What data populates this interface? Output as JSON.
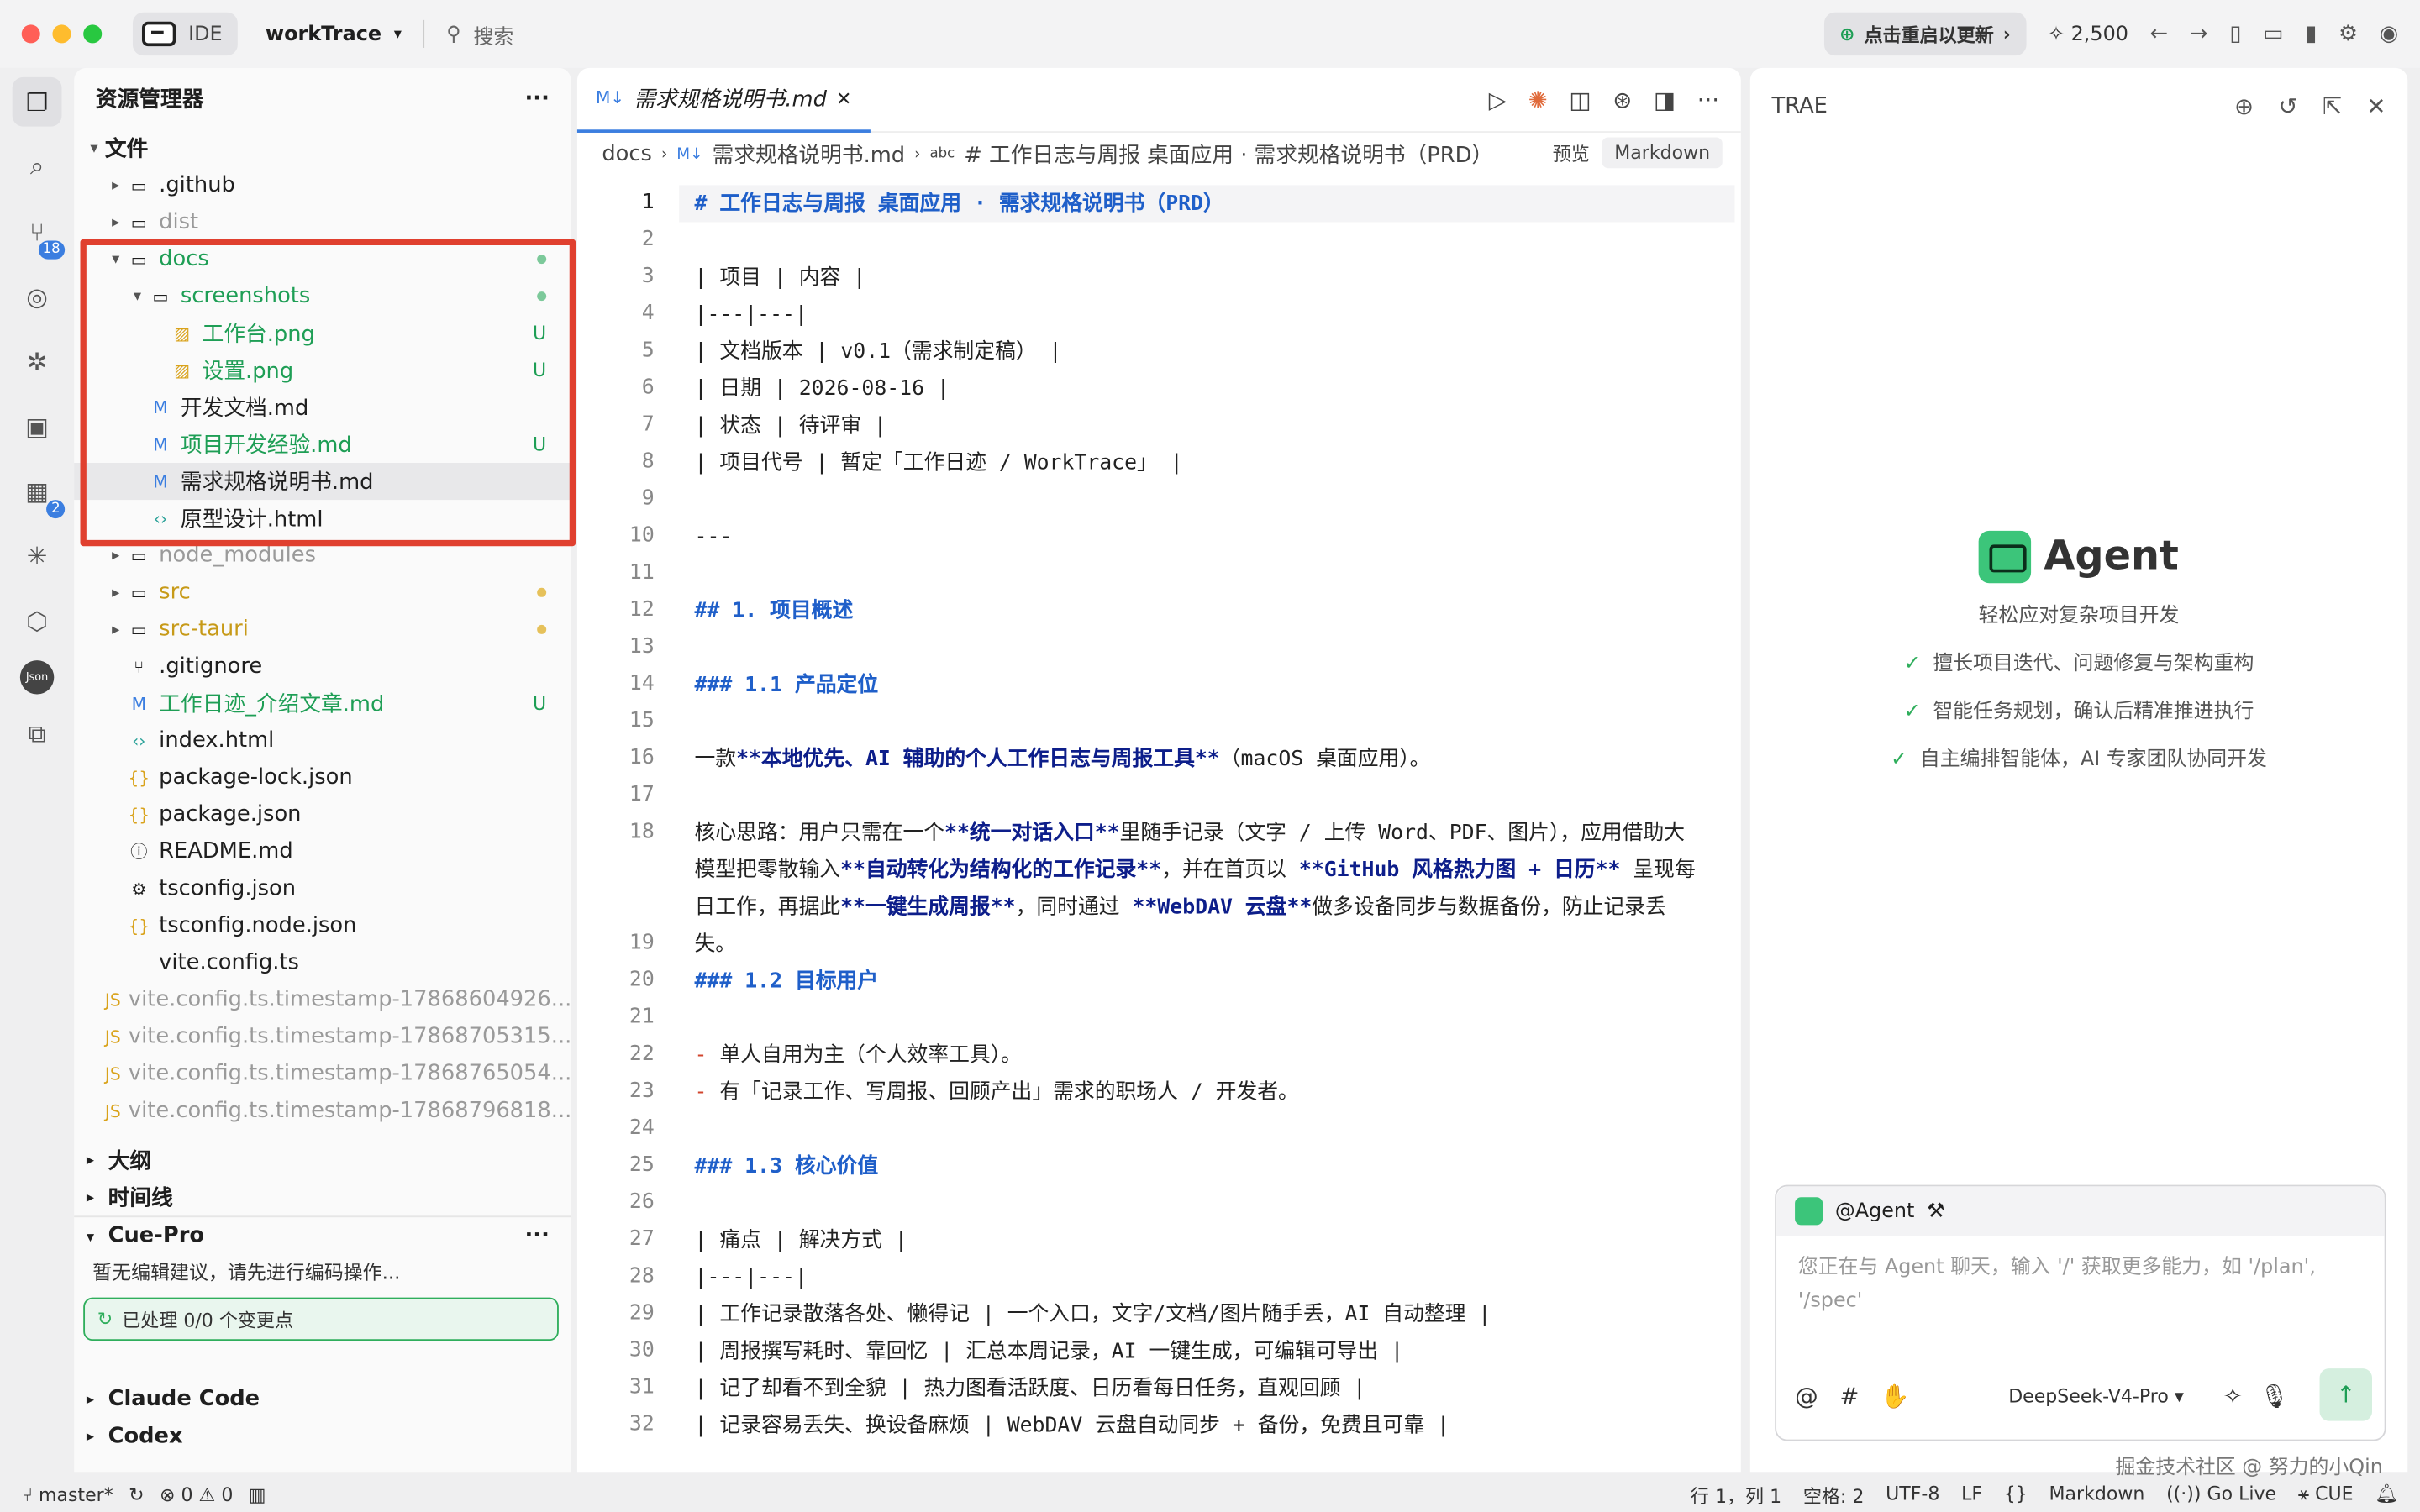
{
  "titlebar": {
    "ide_label": "IDE",
    "project": "workTrace",
    "search": "搜索",
    "restart": "点击重启以更新",
    "credits": "2,500"
  },
  "activity": {
    "badge_scm": "18",
    "badge_ext": "2"
  },
  "explorer": {
    "title": "资源管理器",
    "root": "文件",
    "items": [
      {
        "label": ".github",
        "type": "folder",
        "indent": 1,
        "color": "normal"
      },
      {
        "label": "dist",
        "type": "folder",
        "indent": 1,
        "color": "gray"
      },
      {
        "label": "docs",
        "type": "folder-open",
        "indent": 1,
        "color": "green",
        "status": "dot"
      },
      {
        "label": "screenshots",
        "type": "folder-open",
        "indent": 2,
        "color": "green",
        "status": "dot"
      },
      {
        "label": "工作台.png",
        "type": "image",
        "indent": 3,
        "color": "green",
        "status": "U"
      },
      {
        "label": "设置.png",
        "type": "image",
        "indent": 3,
        "color": "green",
        "status": "U"
      },
      {
        "label": "开发文档.md",
        "type": "md",
        "indent": 2,
        "color": "normal"
      },
      {
        "label": "项目开发经验.md",
        "type": "md",
        "indent": 2,
        "color": "green",
        "status": "U"
      },
      {
        "label": "需求规格说明书.md",
        "type": "md",
        "indent": 2,
        "color": "normal",
        "selected": true
      },
      {
        "label": "原型设计.html",
        "type": "html",
        "indent": 2,
        "color": "normal"
      },
      {
        "label": "node_modules",
        "type": "folder",
        "indent": 1,
        "color": "gray"
      },
      {
        "label": "src",
        "type": "folder",
        "indent": 1,
        "color": "orange",
        "status": "odot"
      },
      {
        "label": "src-tauri",
        "type": "folder",
        "indent": 1,
        "color": "orange",
        "status": "odot"
      },
      {
        "label": ".gitignore",
        "type": "git",
        "indent": 1,
        "color": "normal"
      },
      {
        "label": "工作日迹_介绍文章.md",
        "type": "md",
        "indent": 1,
        "color": "green",
        "status": "U"
      },
      {
        "label": "index.html",
        "type": "html",
        "indent": 1,
        "color": "normal"
      },
      {
        "label": "package-lock.json",
        "type": "json",
        "indent": 1,
        "color": "normal"
      },
      {
        "label": "package.json",
        "type": "json",
        "indent": 1,
        "color": "normal"
      },
      {
        "label": "README.md",
        "type": "info",
        "indent": 1,
        "color": "normal"
      },
      {
        "label": "tsconfig.json",
        "type": "gear",
        "indent": 1,
        "color": "normal"
      },
      {
        "label": "tsconfig.node.json",
        "type": "json",
        "indent": 1,
        "color": "normal"
      },
      {
        "label": "vite.config.ts",
        "type": "blank",
        "indent": 1,
        "color": "normal"
      },
      {
        "label": "vite.config.ts.timestamp-17868604926...",
        "type": "js",
        "indent": 1,
        "color": "gray"
      },
      {
        "label": "vite.config.ts.timestamp-17868705315...",
        "type": "js",
        "indent": 1,
        "color": "gray"
      },
      {
        "label": "vite.config.ts.timestamp-17868765054...",
        "type": "js",
        "indent": 1,
        "color": "gray"
      },
      {
        "label": "vite.config.ts.timestamp-17868796818...",
        "type": "js",
        "indent": 1,
        "color": "gray"
      }
    ],
    "outline": "大纲",
    "timeline": "时间线",
    "cue_title": "Cue-Pro",
    "cue_hint": "暂无编辑建议，请先进行编码操作...",
    "cue_status": "已处理 0/0 个变更点",
    "claude": "Claude Code",
    "codex": "Codex"
  },
  "editor": {
    "tab": "需求规格说明书.md",
    "crumb_1": "docs",
    "crumb_2": "需求规格说明书.md",
    "crumb_3": "# 工作日志与周报 桌面应用 · 需求规格说明书（PRD）",
    "preview": "预览",
    "markdown": "Markdown",
    "lines": [
      {
        "n": "1",
        "t": "# 工作日志与周报 桌面应用 · 需求规格说明书（PRD）",
        "k": "h"
      },
      {
        "n": "2",
        "t": ""
      },
      {
        "n": "3",
        "t": "| 项目 | 内容 |"
      },
      {
        "n": "4",
        "t": "|---|---|"
      },
      {
        "n": "5",
        "t": "| 文档版本 | v0.1（需求制定稿） |"
      },
      {
        "n": "6",
        "t": "| 日期 | 2026-08-16 |"
      },
      {
        "n": "7",
        "t": "| 状态 | 待评审 |"
      },
      {
        "n": "8",
        "t": "| 项目代号 | 暂定「工作日迹 / WorkTrace」 |"
      },
      {
        "n": "9",
        "t": ""
      },
      {
        "n": "10",
        "t": "---"
      },
      {
        "n": "11",
        "t": ""
      },
      {
        "n": "12",
        "t": "## 1. 项目概述",
        "k": "h"
      },
      {
        "n": "13",
        "t": ""
      },
      {
        "n": "14",
        "t": "### 1.1 产品定位",
        "k": "h"
      },
      {
        "n": "15",
        "t": ""
      },
      {
        "n": "16",
        "t": "",
        "k": "l16"
      },
      {
        "n": "17",
        "t": ""
      },
      {
        "n": "18",
        "t": "",
        "k": "l18",
        "rows": 3
      },
      {
        "n": "19",
        "t": ""
      },
      {
        "n": "20",
        "t": "### 1.2 目标用户",
        "k": "h"
      },
      {
        "n": "21",
        "t": ""
      },
      {
        "n": "22",
        "t": "单人自用为主（个人效率工具）。",
        "k": "li"
      },
      {
        "n": "23",
        "t": "有「记录工作、写周报、回顾产出」需求的职场人 / 开发者。",
        "k": "li"
      },
      {
        "n": "24",
        "t": ""
      },
      {
        "n": "25",
        "t": "### 1.3 核心价值",
        "k": "h"
      },
      {
        "n": "26",
        "t": ""
      },
      {
        "n": "27",
        "t": "| 痛点 | 解决方式 |"
      },
      {
        "n": "28",
        "t": "|---|---|"
      },
      {
        "n": "29",
        "t": "| 工作记录散落各处、懒得记 | 一个入口，文字/文档/图片随手丢，AI 自动整理 |"
      },
      {
        "n": "30",
        "t": "| 周报撰写耗时、靠回忆 | 汇总本周记录，AI 一键生成，可编辑可导出 |"
      },
      {
        "n": "31",
        "t": "| 记了却看不到全貌 | 热力图看活跃度、日历看每日任务，直观回顾 |"
      },
      {
        "n": "32",
        "t": "| 记录容易丢失、换设备麻烦 | WebDAV 云盘自动同步 + 备份，免费且可靠 |"
      }
    ],
    "l16": {
      "a": "一款",
      "b": "**本地优先、AI 辅助的个人工作日志与周报工具**",
      "c": "（macOS 桌面应用）。"
    },
    "l18": {
      "a": "核心思路：用户只需在一个",
      "b": "**统一对话入口**",
      "c": "里随手记录（文字 / 上传 Word、PDF、图片），应用借助大模型把零散输入",
      "d": "**自动转化为结构化的工作记录**",
      "e": "，并在首页以 ",
      "f": "**GitHub 风格热力图 + 日历**",
      "g": " 呈现每日工作，再据此",
      "h": "**一键生成周报**",
      "i": "，同时通过 ",
      "j": "**WebDAV 云盘**",
      "k": "做多设备同步与数据备份，防止记录丢失。"
    }
  },
  "agent": {
    "brand": "TRAE",
    "title": "Agent",
    "subtitle": "轻松应对复杂项目开发",
    "features": [
      "擅长项目迭代、问题修复与架构重构",
      "智能任务规划，确认后精准推进执行",
      "自主编排智能体，AI 专家团队协同开发"
    ],
    "mention": "@Agent",
    "placeholder": "您正在与 Agent 聊天，输入 '/' 获取更多能力，如 '/plan', '/spec'",
    "model": "DeepSeek-V4-Pro"
  },
  "status": {
    "branch": "master*",
    "errors": "0",
    "warnings": "0",
    "position": "行 1，列 1",
    "spaces": "空格: 2",
    "encoding": "UTF-8",
    "eol": "LF",
    "lang": "Markdown",
    "golive": "Go Live",
    "cue": "CUE"
  },
  "watermark": "掘金技术社区 @ 努力的小Qin"
}
